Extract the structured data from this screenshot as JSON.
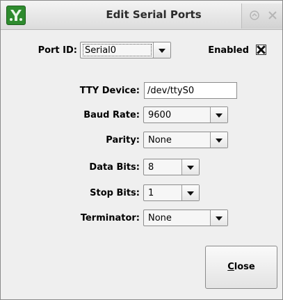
{
  "window": {
    "title": "Edit Serial Ports"
  },
  "icons": {
    "app": "app-logo-icon",
    "title_up": "up-arrow-icon",
    "title_close": "close-icon",
    "dropdown": "chevron-down-icon"
  },
  "port": {
    "label": "Port ID:",
    "value": "Serial0"
  },
  "enabled": {
    "label": "Enabled",
    "checked": true
  },
  "fields": {
    "tty": {
      "label": "TTY Device:",
      "value": "/dev/ttyS0"
    },
    "baud": {
      "label": "Baud Rate:",
      "value": "9600"
    },
    "parity": {
      "label": "Parity:",
      "value": "None"
    },
    "data_bits": {
      "label": "Data Bits:",
      "value": "8"
    },
    "stop_bits": {
      "label": "Stop Bits:",
      "value": "1"
    },
    "terminator": {
      "label": "Terminator:",
      "value": "None"
    }
  },
  "close_button": {
    "mnemonic": "C",
    "rest": "lose"
  },
  "colors": {
    "app_icon": "#2e8b2e",
    "window_bg": "#efefef"
  }
}
